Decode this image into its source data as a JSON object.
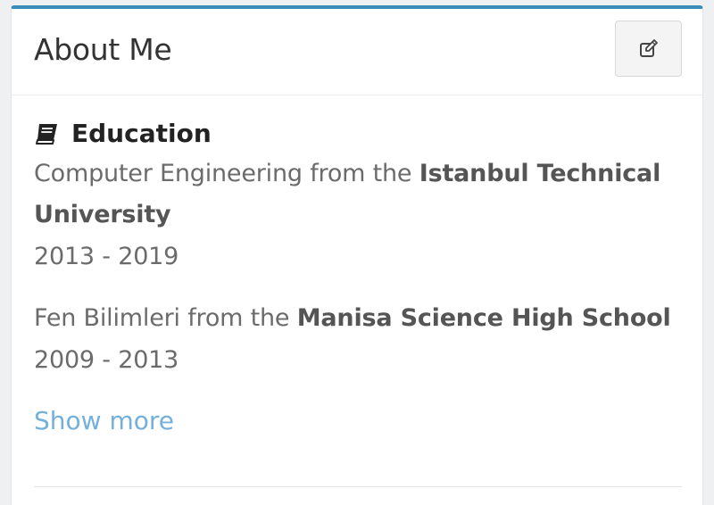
{
  "card": {
    "title": "About Me",
    "edit_icon": "edit-icon"
  },
  "education": {
    "icon": "book-icon",
    "heading": "Education",
    "entries": [
      {
        "degree": "Computer Engineering",
        "connector": "from the",
        "school_line1": "Istanbul Technical",
        "school_line2": "University",
        "years": "2013 - 2019"
      },
      {
        "degree": "Fen Bilimleri",
        "connector": "from the",
        "school": "Manisa Science High School",
        "years": "2009 - 2013"
      }
    ],
    "show_more": "Show more"
  },
  "colors": {
    "accent": "#3c8dbc",
    "link": "#74b0dc",
    "text": "#6b6b6b"
  }
}
